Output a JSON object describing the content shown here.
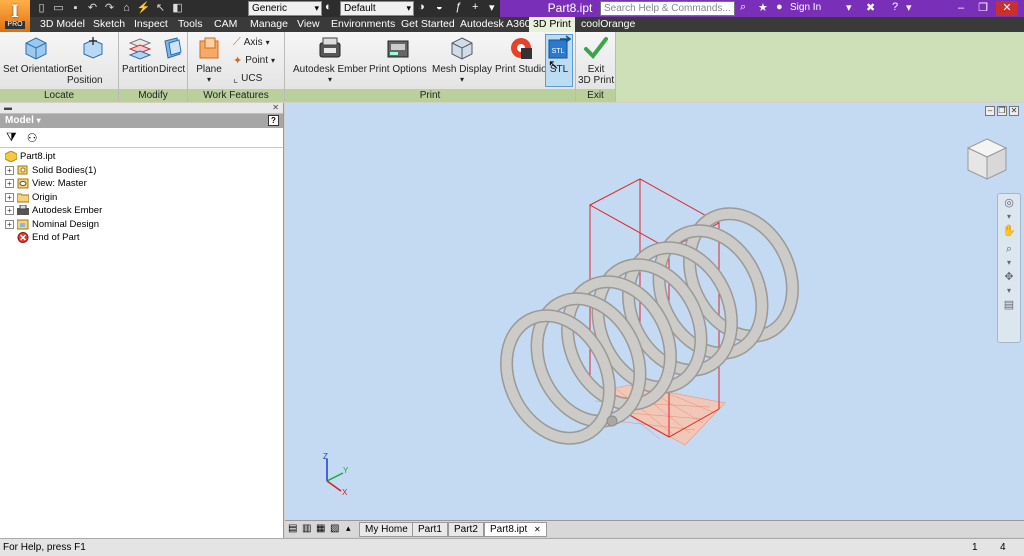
{
  "app": {
    "badge": "PRO",
    "letter": "I"
  },
  "titlebar": {
    "doc_title": "Part8.ipt",
    "material_combo": "Generic",
    "appearance_combo": "Default",
    "search_placeholder": "Search Help & Commands...",
    "signin_label": "Sign In"
  },
  "tabs": [
    "3D Model",
    "Sketch",
    "Inspect",
    "Tools",
    "CAM",
    "Manage",
    "View",
    "Environments",
    "Get Started",
    "Autodesk A360",
    "3D Print",
    "coolOrange"
  ],
  "active_tab": "3D Print",
  "ribbon": {
    "locate": {
      "label": "Locate",
      "set_orientation": "Set Orientation",
      "set_position": "Set Position"
    },
    "modify": {
      "label": "Modify",
      "partition": "Partition",
      "direct": "Direct"
    },
    "work_features": {
      "label": "Work Features",
      "plane": "Plane",
      "axis": "Axis",
      "point": "Point",
      "ucs": "UCS"
    },
    "print": {
      "label": "Print",
      "autodesk_ember": "Autodesk Ember",
      "print_options": "Print Options",
      "mesh_display": "Mesh Display",
      "print_studio": "Print Studio",
      "stl": "STL",
      "stl_badge": "STL"
    },
    "exit": {
      "label": "Exit",
      "exit_line1": "Exit",
      "exit_line2": "3D Print"
    }
  },
  "browser": {
    "header": "Model",
    "tree": [
      {
        "label": "Part8.ipt",
        "icon": "part-icon",
        "expander": false,
        "indent": 0
      },
      {
        "label": "Solid Bodies(1)",
        "icon": "solid-bodies-icon",
        "expander": true,
        "indent": 1
      },
      {
        "label": "View: Master",
        "icon": "view-icon",
        "expander": true,
        "indent": 1
      },
      {
        "label": "Origin",
        "icon": "folder-icon",
        "expander": true,
        "indent": 1
      },
      {
        "label": "Autodesk Ember",
        "icon": "printer-icon",
        "expander": true,
        "indent": 1
      },
      {
        "label": "Nominal Design",
        "icon": "design-icon",
        "expander": true,
        "indent": 1
      },
      {
        "label": "End of Part",
        "icon": "end-of-part-icon",
        "expander": false,
        "indent": 1
      }
    ]
  },
  "doctabs": [
    "My Home",
    "Part1",
    "Part2",
    "Part8.ipt"
  ],
  "active_doctab": "Part8.ipt",
  "status": {
    "help_text": "For Help, press F1",
    "count1": "1",
    "count2": "4"
  },
  "colors": {
    "accent_purple": "#7a2fb8",
    "ribbon_green": "#b9d09b",
    "viewport_bg": "#c3daf2",
    "spring_gray": "#c8c6c2",
    "envelope_red": "#e0262a"
  }
}
